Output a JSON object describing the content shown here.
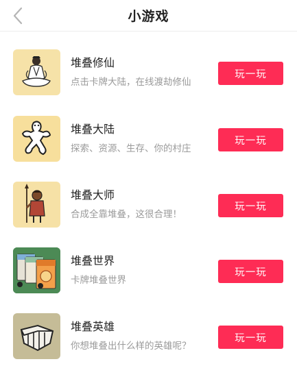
{
  "header": {
    "title": "小游戏",
    "back_icon": "chevron-left-icon"
  },
  "games": [
    {
      "name": "堆叠修仙",
      "desc": "点击卡牌大陆，在线渡劫修仙",
      "button": "玩一玩",
      "icon": "meditating-cultivator-icon",
      "thumb_bg": "#f6e2a8"
    },
    {
      "name": "堆叠大陆",
      "desc": "探索、资源、生存、你的村庄",
      "button": "玩一玩",
      "icon": "stick-figure-icon",
      "thumb_bg": "#f7df9c"
    },
    {
      "name": "堆叠大师",
      "desc": "合成全靠堆叠，这很合理！",
      "button": "玩一玩",
      "icon": "villager-with-spear-icon",
      "thumb_bg": "#f6e1a6"
    },
    {
      "name": "堆叠世界",
      "desc": "卡牌堆叠世界",
      "button": "玩一玩",
      "icon": "card-stack-icon",
      "thumb_bg": "#3f7a4a"
    },
    {
      "name": "堆叠英雄",
      "desc": "你想堆叠出什么样的英雄呢？",
      "button": "玩一玩",
      "icon": "armor-shield-icon",
      "thumb_bg": "#c5bc97"
    }
  ],
  "colors": {
    "accent": "#fe2c55",
    "title": "#222222",
    "subtext": "#9a9a9a"
  }
}
